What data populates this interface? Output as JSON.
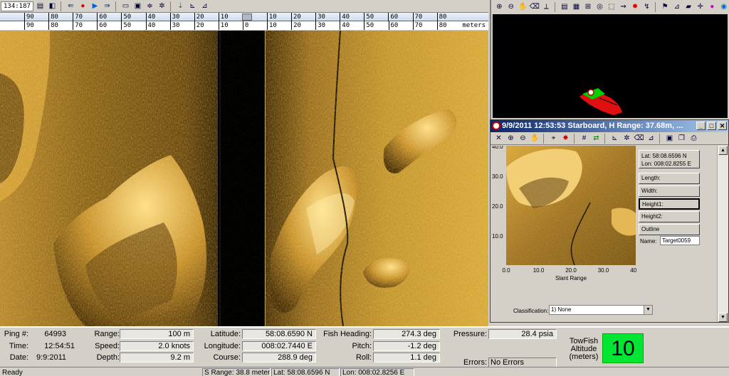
{
  "main_toolbar": {
    "counter": "134:187"
  },
  "ruler": {
    "top_labels": [
      "90",
      "80",
      "70",
      "60",
      "50",
      "40",
      "30",
      "20",
      "10",
      "10",
      "20",
      "30",
      "40",
      "50",
      "60",
      "70",
      "80"
    ],
    "bottom_labels": [
      "90",
      "80",
      "70",
      "60",
      "50",
      "40",
      "30",
      "20",
      "10",
      "0",
      "10",
      "20",
      "30",
      "40",
      "50",
      "60",
      "70",
      "80"
    ],
    "unit": "meters"
  },
  "target_window": {
    "title": "9/9/2011 12:53:53 Starboard, H Range: 37.68m, ...",
    "lat": "Lat:   58:08.6596 N",
    "lon": "Lon:  008:02.8255 E",
    "buttons": [
      "Length:",
      "Width:",
      "Height1:",
      "Height2:",
      "Outline"
    ],
    "name_label": "Name:",
    "name_value": "Target0059",
    "classification_label": "Classification:",
    "classification_value": "1) None",
    "plot": {
      "x_ticks": [
        "0.0",
        "10.0",
        "20.0",
        "30.0",
        "40.0"
      ],
      "y_ticks": [
        "40.0",
        "30.0",
        "20.0",
        "10.0"
      ],
      "xlabel": "Slant Range"
    }
  },
  "data_panel": {
    "ping_label": "Ping #:",
    "ping": "64993",
    "time_label": "Time:",
    "time": "12:54:51",
    "date_label": "Date:",
    "date": "9:9:2011",
    "range_label": "Range:",
    "range": "100 m",
    "speed_label": "Speed:",
    "speed": "2.0 knots",
    "depth_label": "Depth:",
    "depth": "9.2 m",
    "latitude_label": "Latitude:",
    "latitude": "58:08.6590 N",
    "longitude_label": "Longitude:",
    "longitude": "008:02.7440 E",
    "course_label": "Course:",
    "course": "288.9 deg",
    "fish_heading_label": "Fish Heading:",
    "fish_heading": "274.3 deg",
    "pitch_label": "Pitch:",
    "pitch": "-1.2 deg",
    "roll_label": "Roll:",
    "roll": "1.1 deg",
    "pressure_label": "Pressure:",
    "pressure": "28.4 psia",
    "errors_label": "Errors:",
    "errors": "No Errors",
    "altitude_label_1": "TowFish",
    "altitude_label_2": "Altitude",
    "altitude_label_3": "(meters)",
    "altitude": "10"
  },
  "status_bar": {
    "state": "Ready",
    "slant_range": "S Range: 38.8 meters",
    "lat": "Lat: 58:08.6596 N",
    "lon": "Lon: 008:02.8256 E"
  },
  "colors": {
    "sonar_bright": "#e8b848",
    "sonar_dark": "#2a1c06",
    "altitude_box": "#00e632",
    "title_bar": "#0a246a"
  }
}
